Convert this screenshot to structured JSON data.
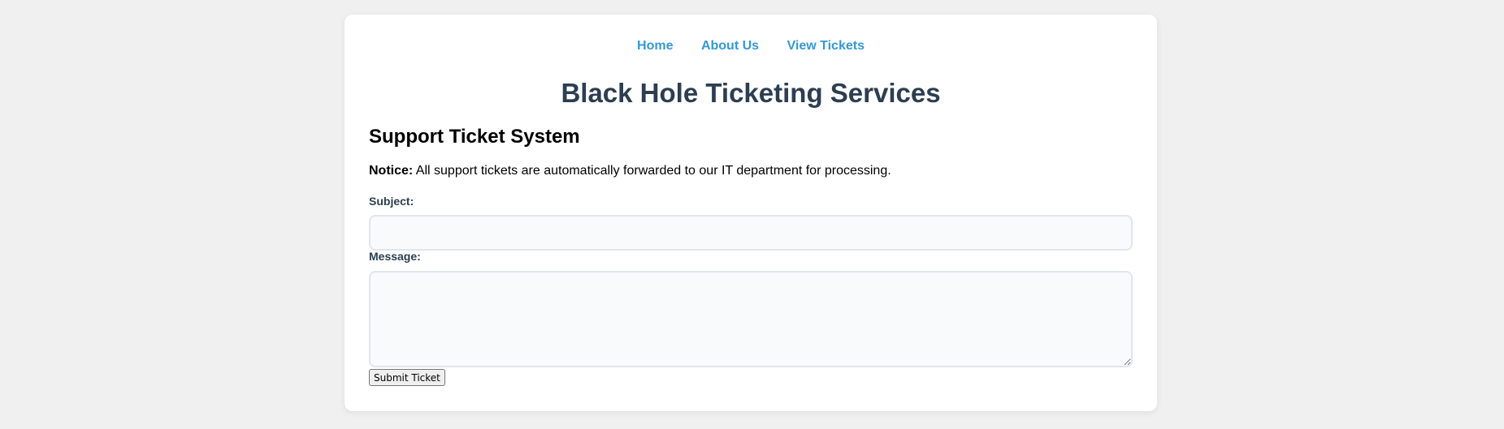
{
  "nav": {
    "items": [
      {
        "label": "Home"
      },
      {
        "label": "About Us"
      },
      {
        "label": "View Tickets"
      }
    ]
  },
  "header": {
    "title": "Black Hole Ticketing Services"
  },
  "main": {
    "section_title": "Support Ticket System",
    "notice_label": "Notice:",
    "notice_text": " All support tickets are automatically forwarded to our IT department for processing.",
    "subject_label": "Subject:",
    "subject_value": "",
    "message_label": "Message:",
    "message_value": "",
    "submit_label": "Submit Ticket"
  },
  "colors": {
    "link": "#3498db",
    "title": "#2c3e50",
    "background": "#f0f0f0"
  }
}
